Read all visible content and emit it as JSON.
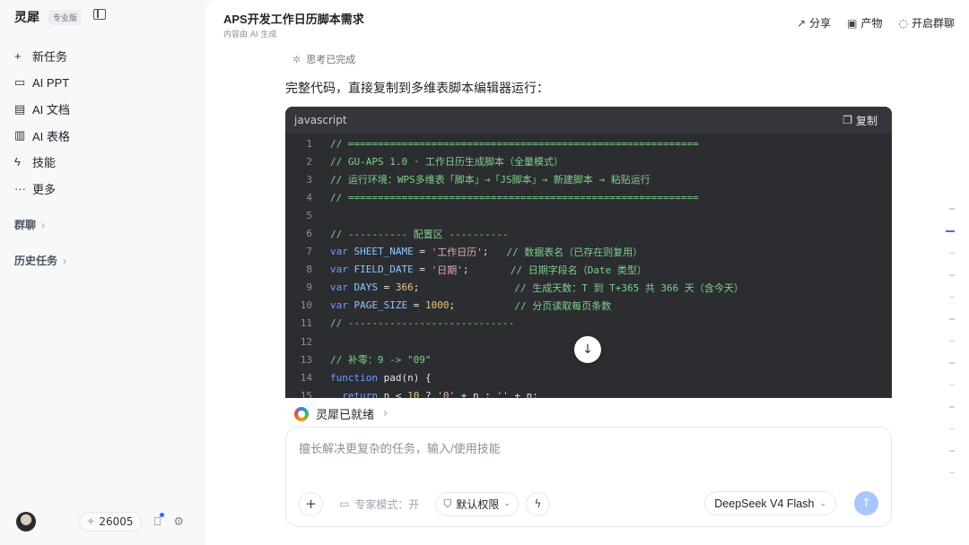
{
  "sidebar": {
    "brand": "灵犀",
    "badge": "专业版",
    "items": [
      {
        "icon": "plus-icon",
        "glyph": "+",
        "label": "新任务"
      },
      {
        "icon": "presentation-icon",
        "glyph": "▭",
        "label": "AI PPT"
      },
      {
        "icon": "document-icon",
        "glyph": "▤",
        "label": "AI 文档"
      },
      {
        "icon": "bar-chart-icon",
        "glyph": "▥",
        "label": "AI 表格"
      },
      {
        "icon": "lightning-icon",
        "glyph": "ϟ",
        "label": "技能"
      },
      {
        "icon": "more-icon",
        "glyph": "···",
        "label": "更多"
      }
    ],
    "sections": [
      {
        "label": "群聊"
      },
      {
        "label": "历史任务"
      }
    ],
    "credits": "26005"
  },
  "header": {
    "title": "APS开发工作日历脚本需求",
    "subtitle": "内容由 AI 生成",
    "actions": [
      {
        "icon": "share-icon",
        "label": "分享"
      },
      {
        "icon": "archive-icon",
        "label": "产物"
      },
      {
        "icon": "chat-icon",
        "label": "开启群聊"
      }
    ]
  },
  "conversation": {
    "thinking": "思考已完成",
    "answer": "完整代码，直接复制到多维表脚本编辑器运行：",
    "code": {
      "language": "javascript",
      "copy_label": "复制",
      "lines": [
        {
          "n": "1",
          "tokens": [
            {
              "t": "// ===========================================================",
              "c": "comment"
            }
          ]
        },
        {
          "n": "2",
          "tokens": [
            {
              "t": "// GU-APS 1.0 · 工作日历生成脚本（全量模式）",
              "c": "comment"
            }
          ]
        },
        {
          "n": "3",
          "tokens": [
            {
              "t": "// 运行环境：WPS多维表「脚本」→「JS脚本」→ 新建脚本 → 粘贴运行",
              "c": "comment"
            }
          ]
        },
        {
          "n": "4",
          "tokens": [
            {
              "t": "// ===========================================================",
              "c": "comment"
            }
          ]
        },
        {
          "n": "5",
          "tokens": []
        },
        {
          "n": "6",
          "tokens": [
            {
              "t": "// ---------- 配置区 ----------",
              "c": "comment"
            }
          ]
        },
        {
          "n": "7",
          "tokens": [
            {
              "t": "var ",
              "c": "kw"
            },
            {
              "t": "SHEET_NAME",
              "c": "var"
            },
            {
              "t": " = ",
              "c": "plain"
            },
            {
              "t": "'工作日历'",
              "c": "str"
            },
            {
              "t": ";   ",
              "c": "plain"
            },
            {
              "t": "// 数据表名（已存在则复用）",
              "c": "comment"
            }
          ]
        },
        {
          "n": "8",
          "tokens": [
            {
              "t": "var ",
              "c": "kw"
            },
            {
              "t": "FIELD_DATE",
              "c": "var"
            },
            {
              "t": " = ",
              "c": "plain"
            },
            {
              "t": "'日期'",
              "c": "str"
            },
            {
              "t": ";       ",
              "c": "plain"
            },
            {
              "t": "// 日期字段名（Date 类型）",
              "c": "comment"
            }
          ]
        },
        {
          "n": "9",
          "tokens": [
            {
              "t": "var ",
              "c": "kw"
            },
            {
              "t": "DAYS",
              "c": "var"
            },
            {
              "t": " = ",
              "c": "plain"
            },
            {
              "t": "366",
              "c": "num"
            },
            {
              "t": ";                ",
              "c": "plain"
            },
            {
              "t": "// 生成天数：T 到 T+365 共 366 天（含今天）",
              "c": "comment"
            }
          ]
        },
        {
          "n": "10",
          "tokens": [
            {
              "t": "var ",
              "c": "kw"
            },
            {
              "t": "PAGE_SIZE",
              "c": "var"
            },
            {
              "t": " = ",
              "c": "plain"
            },
            {
              "t": "1000",
              "c": "num"
            },
            {
              "t": ";          ",
              "c": "plain"
            },
            {
              "t": "// 分页读取每页条数",
              "c": "comment"
            }
          ]
        },
        {
          "n": "11",
          "tokens": [
            {
              "t": "// ----------------------------",
              "c": "comment"
            }
          ]
        },
        {
          "n": "12",
          "tokens": []
        },
        {
          "n": "13",
          "tokens": [
            {
              "t": "// 补零：9 -> \"09\"",
              "c": "comment"
            }
          ]
        },
        {
          "n": "14",
          "tokens": [
            {
              "t": "function ",
              "c": "kw"
            },
            {
              "t": "pad(n) {",
              "c": "plain"
            }
          ]
        },
        {
          "n": "15",
          "tokens": [
            {
              "t": "  return ",
              "c": "kw"
            },
            {
              "t": "n < ",
              "c": "plain"
            },
            {
              "t": "10",
              "c": "num"
            },
            {
              "t": " ? ",
              "c": "plain"
            },
            {
              "t": "'0'",
              "c": "str"
            },
            {
              "t": " + n : ",
              "c": "plain"
            },
            {
              "t": "''",
              "c": "str"
            },
            {
              "t": " + n;",
              "c": "plain"
            }
          ]
        }
      ]
    },
    "status": "灵犀已就绪"
  },
  "composer": {
    "placeholder": "擅长解决更复杂的任务，输入/使用技能",
    "value": "",
    "expert_mode": "专家模式：开",
    "permission": "默认权限",
    "model": "DeepSeek V4 Flash"
  },
  "colors": {
    "accent": "#4f6bd6",
    "send_button": "#a9c6ff",
    "code_bg": "#2b2d31"
  }
}
